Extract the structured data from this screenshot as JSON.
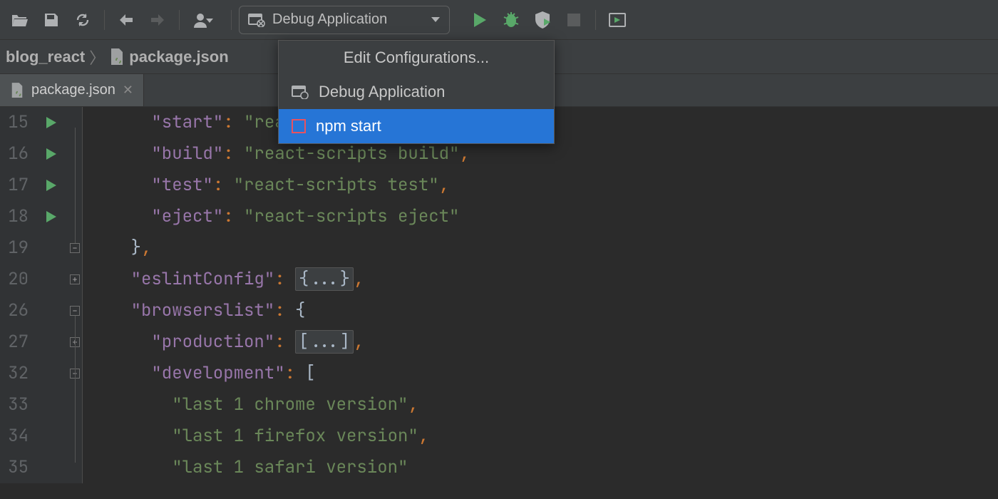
{
  "toolbar": {
    "run_config_label": "Debug Application"
  },
  "breadcrumbs": {
    "project": "blog_react",
    "file": "package.json"
  },
  "tabs": [
    {
      "label": "package.json"
    }
  ],
  "dropdown": {
    "edit": "Edit Configurations...",
    "debug": "Debug Application",
    "npm": "npm start"
  },
  "editor": {
    "lines": [
      {
        "num": "15",
        "runnable": true,
        "indent": "      ",
        "key": "\"start\"",
        "sep": ": ",
        "val": "\"rea",
        "comma": ""
      },
      {
        "num": "16",
        "runnable": true,
        "indent": "      ",
        "key": "\"build\"",
        "sep": ": ",
        "val": "\"react-scripts build\"",
        "comma": ","
      },
      {
        "num": "17",
        "runnable": true,
        "indent": "      ",
        "key": "\"test\"",
        "sep": ": ",
        "val": "\"react-scripts test\"",
        "comma": ","
      },
      {
        "num": "18",
        "runnable": true,
        "indent": "      ",
        "key": "\"eject\"",
        "sep": ": ",
        "val": "\"react-scripts eject\"",
        "comma": ""
      },
      {
        "num": "19",
        "runnable": false,
        "indent": "    ",
        "raw_close": "}",
        "comma": ","
      },
      {
        "num": "20",
        "runnable": false,
        "indent": "    ",
        "key": "\"eslintConfig\"",
        "sep": ": ",
        "folded": "{...}",
        "comma": ","
      },
      {
        "num": "26",
        "runnable": false,
        "indent": "    ",
        "key": "\"browserslist\"",
        "sep": ": ",
        "open": "{",
        "comma": ""
      },
      {
        "num": "27",
        "runnable": false,
        "indent": "      ",
        "key": "\"production\"",
        "sep": ": ",
        "folded": "[...]",
        "comma": ","
      },
      {
        "num": "32",
        "runnable": false,
        "indent": "      ",
        "key": "\"development\"",
        "sep": ": ",
        "open": "[",
        "comma": ""
      },
      {
        "num": "33",
        "runnable": false,
        "indent": "        ",
        "val": "\"last 1 chrome version\"",
        "comma": ","
      },
      {
        "num": "34",
        "runnable": false,
        "indent": "        ",
        "val": "\"last 1 firefox version\"",
        "comma": ","
      },
      {
        "num": "35",
        "runnable": false,
        "indent": "        ",
        "val": "\"last 1 safari version\"",
        "comma": ""
      }
    ]
  }
}
